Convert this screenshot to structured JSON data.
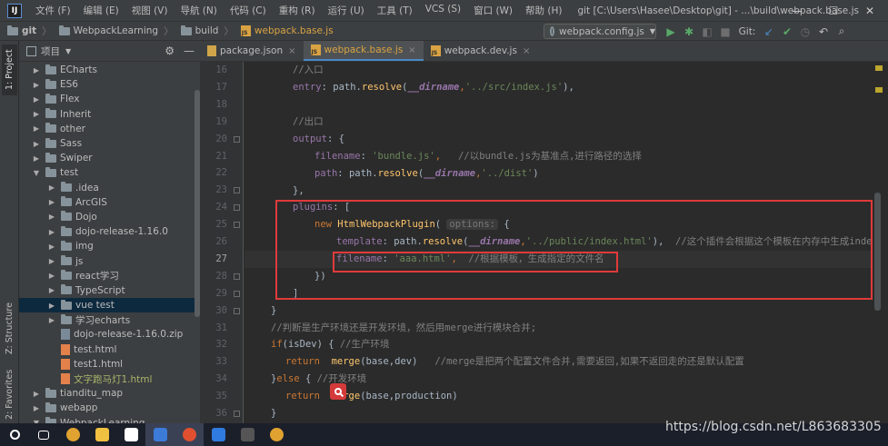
{
  "titlebar": {
    "menu": [
      "文件 (F)",
      "编辑 (E)",
      "视图 (V)",
      "导航 (N)",
      "代码 (C)",
      "重构 (R)",
      "运行 (U)",
      "工具 (T)",
      "VCS (S)",
      "窗口 (W)",
      "帮助 (H)"
    ],
    "window_title": "git [C:\\Users\\Hasee\\Desktop\\git] - ...\\build\\webpack.base.js",
    "minimize": "—",
    "maximize": "☐",
    "close": "✕"
  },
  "navbar": {
    "crumbs": [
      "git",
      "WebpackLearning",
      "build",
      "webpack.base.js"
    ],
    "run_config": "webpack.config.js",
    "git_label": "Git:"
  },
  "left_strip": {
    "tabs": [
      "1: Project",
      "Z: Structure",
      "2: Favorites"
    ]
  },
  "project_panel": {
    "title": "项目",
    "caret": "▼",
    "settings_glyph": "⚙",
    "hide_glyph": "—",
    "items": [
      {
        "label": "ECharts",
        "kind": "folder",
        "expanded": false
      },
      {
        "label": "ES6",
        "kind": "folder",
        "expanded": false
      },
      {
        "label": "Flex",
        "kind": "folder",
        "expanded": false
      },
      {
        "label": "Inherit",
        "kind": "folder",
        "expanded": false
      },
      {
        "label": "other",
        "kind": "folder",
        "expanded": false
      },
      {
        "label": "Sass",
        "kind": "folder",
        "expanded": false
      },
      {
        "label": "Swiper",
        "kind": "folder",
        "expanded": false
      },
      {
        "label": "test",
        "kind": "folder",
        "expanded": true
      },
      {
        "label": ".idea",
        "kind": "folder",
        "expanded": false
      },
      {
        "label": "ArcGIS",
        "kind": "folder",
        "expanded": false
      },
      {
        "label": "Dojo",
        "kind": "folder",
        "expanded": false
      },
      {
        "label": "dojo-release-1.16.0",
        "kind": "folder",
        "expanded": false
      },
      {
        "label": "img",
        "kind": "folder",
        "expanded": false
      },
      {
        "label": "js",
        "kind": "folder",
        "expanded": false
      },
      {
        "label": "react学习",
        "kind": "folder",
        "expanded": false
      },
      {
        "label": "TypeScript",
        "kind": "folder",
        "expanded": false
      },
      {
        "label": "vue test",
        "kind": "folder",
        "expanded": false,
        "selected": true
      },
      {
        "label": "学习echarts",
        "kind": "folder",
        "expanded": false
      },
      {
        "label": "dojo-release-1.16.0.zip",
        "kind": "zip"
      },
      {
        "label": "test.html",
        "kind": "html"
      },
      {
        "label": "test1.html",
        "kind": "html"
      },
      {
        "label": "文字跑马灯1.html",
        "kind": "html",
        "modified": true
      },
      {
        "label": "tianditu_map",
        "kind": "folder",
        "expanded": false
      },
      {
        "label": "webapp",
        "kind": "folder",
        "expanded": false
      },
      {
        "label": "WebpackLearning",
        "kind": "folder",
        "expanded": true
      }
    ]
  },
  "editor_tabs": [
    {
      "label": "package.json",
      "active": false,
      "close": "×"
    },
    {
      "label": "webpack.base.js",
      "active": true,
      "close": "×"
    },
    {
      "label": "webpack.dev.js",
      "active": false,
      "close": "×"
    }
  ],
  "editor": {
    "line_numbers": [
      "16",
      "17",
      "18",
      "19",
      "20",
      "21",
      "22",
      "23",
      "24",
      "25",
      "26",
      "27",
      "28",
      "29",
      "30",
      "31",
      "32",
      "33",
      "34",
      "35",
      "36"
    ],
    "current_line": "27",
    "code": {
      "l16": "//入口",
      "l17_a": "entry",
      "l17_b": ": path.",
      "l17_c": "resolve",
      "l17_d": "(",
      "l17_e": "__dirname",
      "l17_f": ",",
      "l17_g": "'../src/index.js'",
      "l17_h": "),",
      "l19": "//出口",
      "l20_a": "output",
      "l20_b": ": {",
      "l21_a": "filename",
      "l21_b": ": ",
      "l21_c": "'bundle.js'",
      "l21_d": ",   ",
      "l21_e": "//以bundle.js为基准点,进行路径的选择",
      "l22_a": "path",
      "l22_b": ": path.",
      "l22_c": "resolve",
      "l22_d": "(",
      "l22_e": "__dirname",
      "l22_f": ",",
      "l22_g": "'../dist'",
      "l22_h": ")",
      "l23": "},",
      "l24_a": "plugins",
      "l24_b": ": [",
      "l25_a": "new ",
      "l25_b": "HtmlWebpackPlugin",
      "l25_c": "( ",
      "l25_hint": "options:",
      "l25_d": " {",
      "l26_a": "template",
      "l26_b": ": path.",
      "l26_c": "resolve",
      "l26_d": "(",
      "l26_e": "__dirname",
      "l26_f": ",",
      "l26_g": "'../public/index.html'",
      "l26_h": "),  ",
      "l26_i": "//这个插件会根据这个模板在内存中生成index.",
      "l27_a": "filename",
      "l27_b": ": ",
      "l27_c": "'aaa.html'",
      "l27_d": ",  ",
      "l27_e": "//根据模板，生成指定的文件名",
      "l28": "})",
      "l29": "]",
      "l30": "}",
      "l31": "//判断是生产环境还是开发环境，然后用merge进行模块合并;",
      "l32_a": "if",
      "l32_b": "(isDev) { ",
      "l32_c": "//生产环境",
      "l33_a": "return  ",
      "l33_b": "merge",
      "l33_c": "(base,dev)   ",
      "l33_d": "//merge是把两个配置文件合并,需要返回,如果不返回走的还是默认配置",
      "l34_a": "}",
      "l34_b": "else",
      "l34_c": " { ",
      "l34_d": "//开发环境",
      "l35_a": "return  ",
      "l35_b": "merge",
      "l35_c": "(base,production)",
      "l36": "}"
    }
  },
  "watermark": "https://blog.csdn.net/L863683305",
  "taskbar": {
    "apps": [
      "search",
      "task-view",
      "chrome",
      "explorer",
      "calculator",
      "intellij",
      "chrome-2",
      "app-blue",
      "terminal",
      "chrome-3"
    ]
  },
  "colors": {
    "accent_tab": "#4a88c7",
    "highlight_box": "#e03a3a",
    "file_modified": "#a9b46a"
  }
}
